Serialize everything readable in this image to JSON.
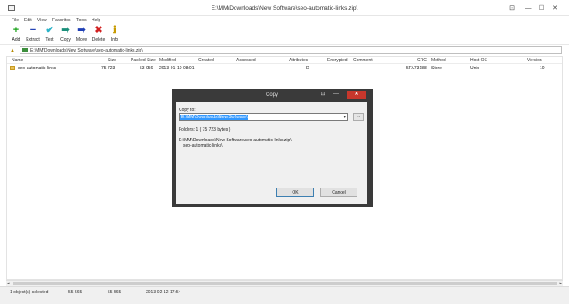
{
  "window": {
    "title": "E:\\MM\\Downloads\\New Software\\seo-automatic-links.zip\\",
    "controls": {
      "key": "⊡",
      "min": "—",
      "max": "☐",
      "close": "✕"
    }
  },
  "menu": [
    "File",
    "Edit",
    "View",
    "Favorites",
    "Tools",
    "Help"
  ],
  "toolbar": [
    {
      "label": "Add",
      "glyph": "+",
      "color": "#1aa31a",
      "icon": "add-icon"
    },
    {
      "label": "Extract",
      "glyph": "−",
      "color": "#1f3fb5",
      "icon": "extract-icon"
    },
    {
      "label": "Test",
      "glyph": "✔",
      "color": "#2bb3c8",
      "icon": "test-icon"
    },
    {
      "label": "Copy",
      "glyph": "➡",
      "color": "#1a8f7a",
      "icon": "copy-icon"
    },
    {
      "label": "Move",
      "glyph": "➡",
      "color": "#1f3fb5",
      "icon": "move-icon"
    },
    {
      "label": "Delete",
      "glyph": "✖",
      "color": "#d12020",
      "icon": "delete-icon"
    },
    {
      "label": "Info",
      "glyph": "ℹ",
      "color": "#c79a00",
      "icon": "info-icon"
    }
  ],
  "address": {
    "path": "E:\\MM\\Downloads\\New Software\\seo-automatic-links.zip\\"
  },
  "columns": {
    "name": "Name",
    "size": "Size",
    "packed": "Packed Size",
    "modified": "Modified",
    "created": "Created",
    "accessed": "Accessed",
    "attributes": "Attributes",
    "encrypted": "Encrypted",
    "comment": "Comment",
    "crc": "CRC",
    "method": "Method",
    "hostos": "Host OS",
    "version": "Version"
  },
  "rows": [
    {
      "name": "seo-automatic-links",
      "size": "75 723",
      "packed": "53 056",
      "modified": "2013-01-10 08:01",
      "created": "",
      "accessed": "",
      "attributes": "D",
      "encrypted": "-",
      "comment": "",
      "crc": "5FA73188",
      "method": "Store",
      "hostos": "Unix",
      "version": "10"
    }
  ],
  "status": {
    "selected": "1 object(s) selected",
    "size": "55 565",
    "packed": "55 565",
    "date": "2013-02-12 17:54"
  },
  "dialog": {
    "title": "Copy",
    "copy_to_label": "Copy to:",
    "path_value": "E:\\MM\\Downloads\\New Software\\",
    "browse_label": "...",
    "folders_line": "Folders: 1     ( 75 723 bytes )",
    "source_line1": "E:\\MM\\Downloads\\New Software\\seo-automatic-links.zip\\",
    "source_line2": "seo-automatic-links\\",
    "ok_label": "OK",
    "cancel_label": "Cancel"
  }
}
